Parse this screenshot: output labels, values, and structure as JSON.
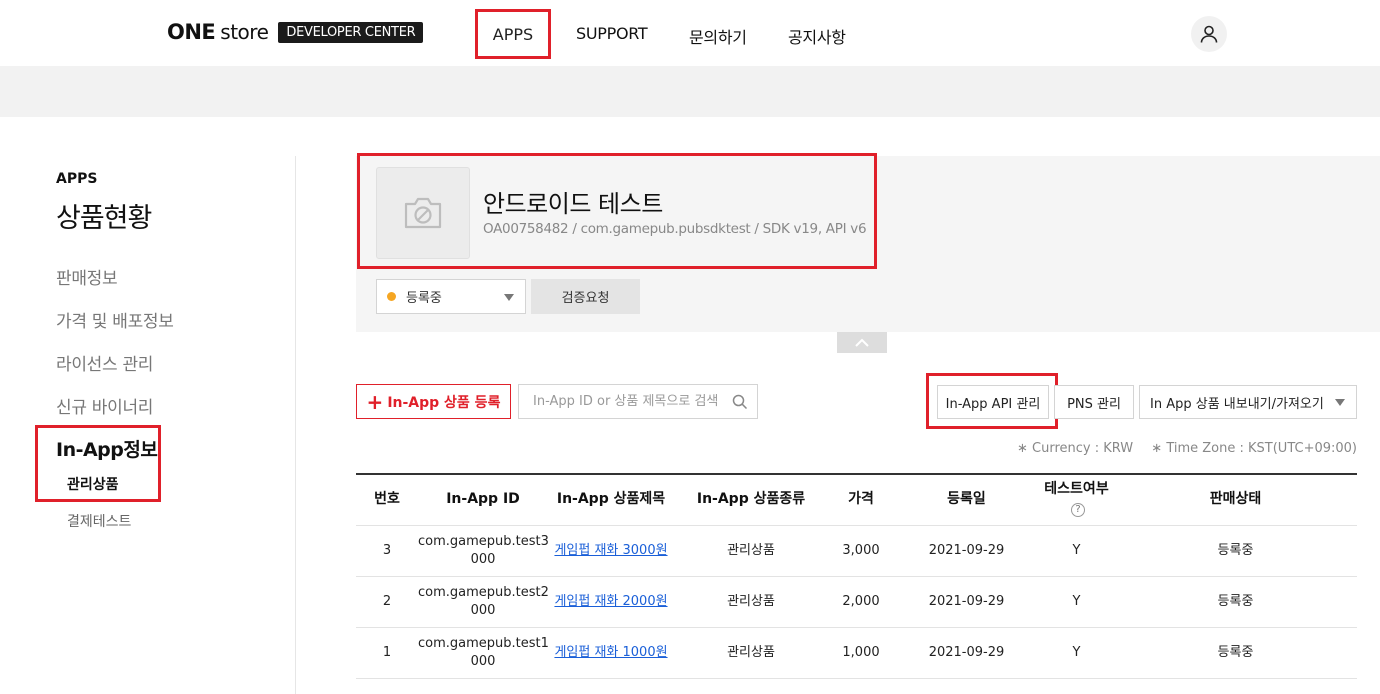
{
  "header": {
    "logo_one": "ONE",
    "logo_store": "store",
    "logo_badge": "DEVELOPER CENTER",
    "nav": [
      "APPS",
      "SUPPORT",
      "문의하기",
      "공지사항"
    ]
  },
  "sidebar": {
    "section_label": "APPS",
    "title": "상품현황",
    "items": [
      "판매정보",
      "가격 및 배포정보",
      "라이선스 관리",
      "신규 바이너리"
    ],
    "inapp_title": "In-App정보",
    "inapp_items": [
      "관리상품",
      "결제테스트"
    ]
  },
  "app": {
    "name": "안드로이드 테스트",
    "meta": "OA00758482 / com.gamepub.pubsdktest / SDK v19, API v6",
    "status": "등록중",
    "verify_label": "검증요청"
  },
  "toolbar": {
    "add_label": "In-App 상품 등록",
    "search_placeholder": "In-App ID or 상품 제목으로 검색",
    "api_label": "In-App API 관리",
    "pns_label": "PNS 관리",
    "export_label": "In App 상품 내보내기/가져오기",
    "currency": "∗ Currency : KRW",
    "timezone": "∗ Time Zone : KST(UTC+09:00)"
  },
  "table": {
    "headers": [
      "번호",
      "In-App ID",
      "In-App 상품제목",
      "In-App 상품종류",
      "가격",
      "등록일",
      "테스트여부",
      "판매상태"
    ],
    "rows": [
      {
        "no": "3",
        "id_line1": "com.gamepub.test3",
        "id_line2": "000",
        "title": "게임펍 재화 3000원",
        "type": "관리상품",
        "price": "3,000",
        "date": "2021-09-29",
        "test": "Y",
        "status": "등록중"
      },
      {
        "no": "2",
        "id_line1": "com.gamepub.test2",
        "id_line2": "000",
        "title": "게임펍 재화 2000원",
        "type": "관리상품",
        "price": "2,000",
        "date": "2021-09-29",
        "test": "Y",
        "status": "등록중"
      },
      {
        "no": "1",
        "id_line1": "com.gamepub.test1",
        "id_line2": "000",
        "title": "게임펍 재화 1000원",
        "type": "관리상품",
        "price": "1,000",
        "date": "2021-09-29",
        "test": "Y",
        "status": "등록중"
      }
    ]
  },
  "colors": {
    "accent": "#e0202a",
    "link": "#1a5fd8",
    "status_dot": "#f5a623"
  }
}
